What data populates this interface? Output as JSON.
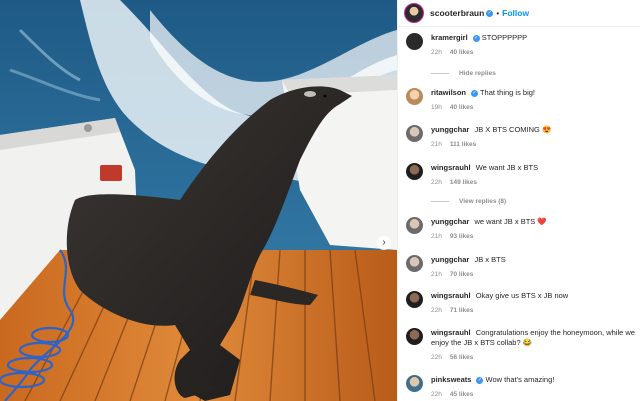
{
  "post": {
    "username": "scooterbraun",
    "follow_label": "Follow",
    "separator": "•"
  },
  "media": {
    "next_arrow": "›"
  },
  "comments": [
    {
      "username": "kramergirl",
      "verified": true,
      "text": "STOPPPPPP",
      "age": "22h",
      "likes": "40 likes",
      "avatar_color": "#2a2a2a"
    },
    {
      "username": "ritawilson",
      "verified": true,
      "text": "That thing is big!",
      "age": "19h",
      "likes": "40 likes",
      "avatar_color": "#c9a27a"
    },
    {
      "username": "yunggchar",
      "verified": false,
      "text": "JB X BTS COMING 😍",
      "age": "21h",
      "likes": "111 likes",
      "avatar_color": "#8a8a8a"
    },
    {
      "username": "wingsrauhl",
      "verified": false,
      "text": "We want JB x BTS",
      "age": "22h",
      "likes": "149 likes",
      "avatar_color": "#3a3a3a"
    },
    {
      "username": "yunggchar",
      "verified": false,
      "text": "we want JB x BTS ❤️",
      "age": "21h",
      "likes": "93 likes",
      "avatar_color": "#8a8a8a"
    },
    {
      "username": "yunggchar",
      "verified": false,
      "text": "JB x BTS",
      "age": "21h",
      "likes": "70 likes",
      "avatar_color": "#8a8a8a"
    },
    {
      "username": "wingsrauhl",
      "verified": false,
      "text": "Okay give us BTS x JB now",
      "age": "22h",
      "likes": "71 likes",
      "avatar_color": "#3a3a3a"
    },
    {
      "username": "wingsrauhl",
      "verified": false,
      "text": "Congratulations enjoy the honeymoon, while we enjoy the JB x BTS collab? 😂",
      "age": "22h",
      "likes": "56 likes",
      "avatar_color": "#3a3a3a"
    },
    {
      "username": "pinksweats",
      "verified": true,
      "text": "Wow that's amazing!",
      "age": "22h",
      "likes": "45 likes",
      "avatar_color": "#4a7a9a"
    }
  ],
  "reply_toggles": [
    {
      "label": "Hide replies"
    },
    {
      "label": "View replies (8)"
    }
  ],
  "colors": {
    "accent": "#0095f6",
    "verified": "#3897f0",
    "muted": "#8e8e8e"
  }
}
